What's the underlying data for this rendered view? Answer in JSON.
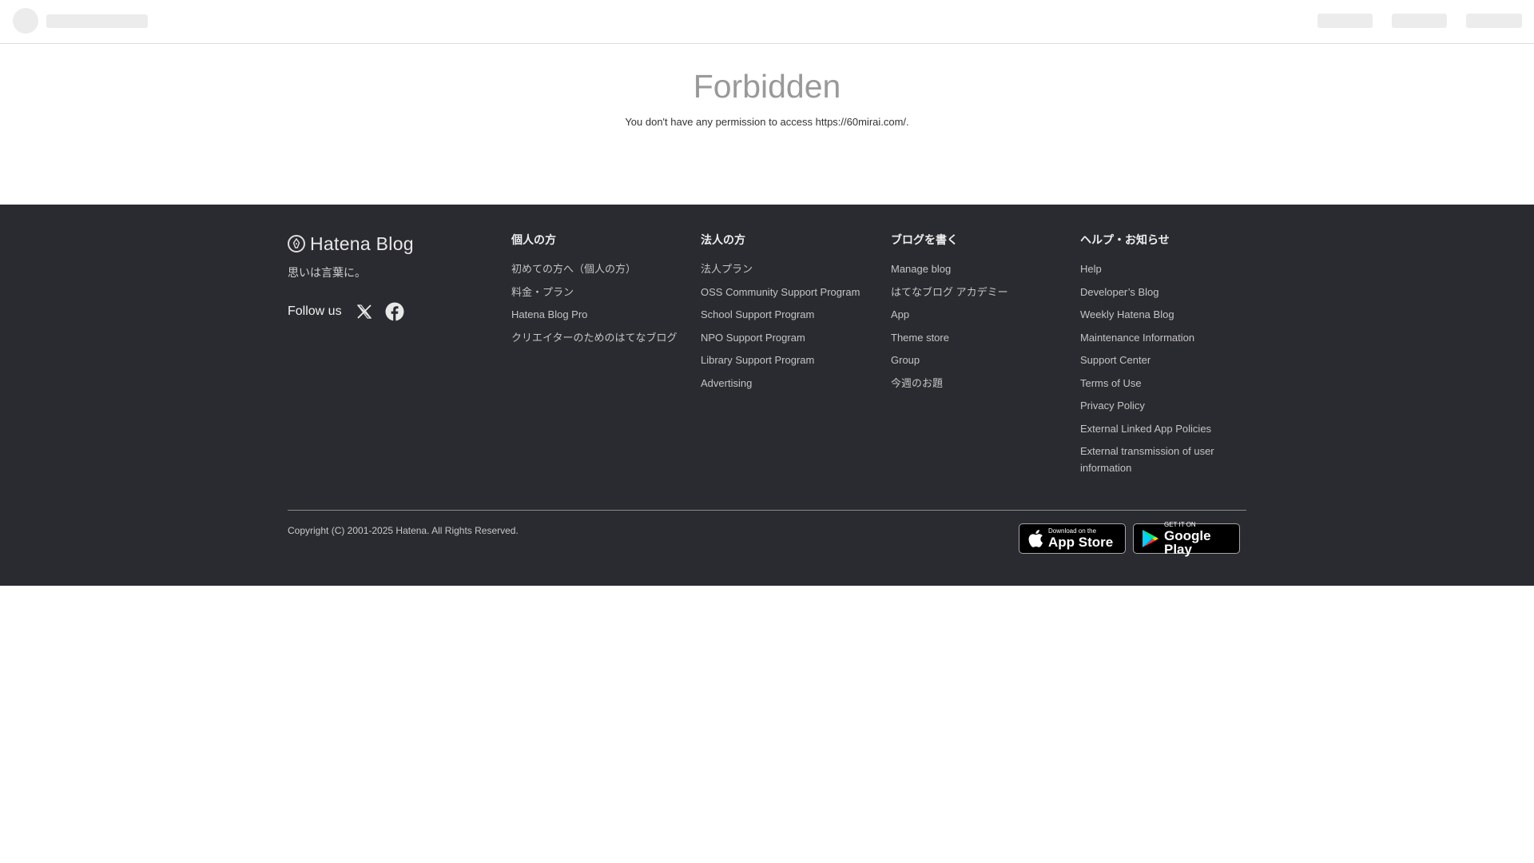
{
  "error": {
    "title": "Forbidden",
    "message": "You don't have any permission to access https://60mirai.com/."
  },
  "footer": {
    "brand": {
      "logo_text": "Hatena Blog",
      "tagline": "思いは言葉に。",
      "follow_label": "Follow us"
    },
    "columns": [
      {
        "heading": "個人の方",
        "links": [
          "初めての方へ（個人の方）",
          "料金・プラン",
          "Hatena Blog Pro",
          "クリエイターのためのはてなブログ"
        ]
      },
      {
        "heading": "法人の方",
        "links": [
          "法人プラン",
          "OSS Community Support Program",
          "School Support Program",
          "NPO Support Program",
          "Library Support Program",
          "Advertising"
        ]
      },
      {
        "heading": "ブログを書く",
        "links": [
          "Manage blog",
          "はてなブログ アカデミー",
          "App",
          "Theme store",
          "Group",
          "今週のお題"
        ]
      },
      {
        "heading": "ヘルプ・お知らせ",
        "links": [
          "Help",
          "Developer’s Blog",
          "Weekly Hatena Blog",
          "Maintenance Information",
          "Support Center",
          "Terms of Use",
          "Privacy Policy",
          "External Linked App Policies",
          "External transmission of user information"
        ]
      }
    ],
    "copyright": "Copyright (C) 2001-2025 Hatena. All Rights Reserved.",
    "stores": {
      "appstore_small": "Download on the",
      "appstore_big": "App Store",
      "googleplay_small": "GET IT ON",
      "googleplay_big": "Google Play"
    }
  },
  "colors": {
    "footer_bg": "#2a2b30",
    "skeleton": "#ececec",
    "error_title": "#999999"
  }
}
